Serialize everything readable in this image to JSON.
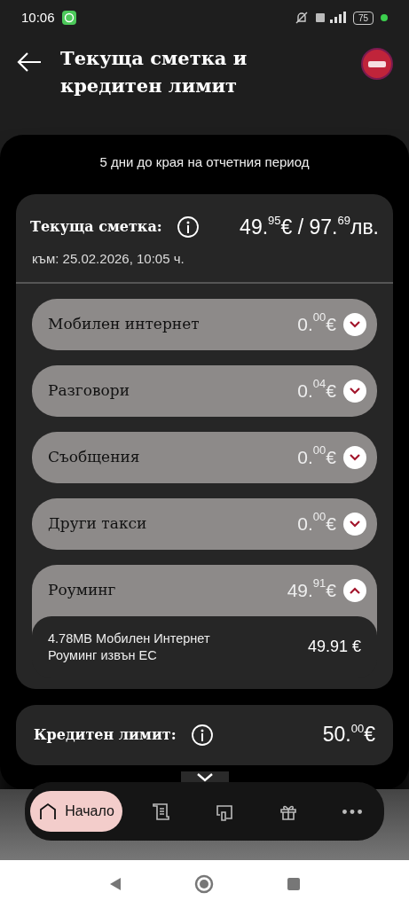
{
  "status_bar": {
    "time": "10:06",
    "battery": "75"
  },
  "header": {
    "title": "Текуща сметка и кредитен лимит"
  },
  "period_note": "5 дни до края на отчетния период",
  "current_bill": {
    "label": "Текуща сметка:",
    "amount": "49.$^{95}$€ / 97.$^{69}$лв.",
    "as_of": "към: 25.02.2026, 10:05 ч."
  },
  "categories": [
    {
      "label": "Мобилен интернет",
      "amount": "0.$^{00}$€",
      "expanded": false
    },
    {
      "label": "Разговори",
      "amount": "0.$^{04}$€",
      "expanded": false
    },
    {
      "label": "Съобщения",
      "amount": "0.$^{00}$€",
      "expanded": false
    },
    {
      "label": "Други такси",
      "amount": "0.$^{00}$€",
      "expanded": false
    },
    {
      "label": "Роуминг",
      "amount": "49.$^{91}$€",
      "expanded": true,
      "details": [
        {
          "description": "4.78MB Мобилен Интернет Роуминг извън ЕС",
          "amount": "49.91 €"
        }
      ]
    }
  ],
  "credit_limit": {
    "label": "Кредитен лимит:",
    "amount": "50.$^{00}$€"
  },
  "bottom_nav": [
    {
      "kind": "home",
      "label": "Начало",
      "selected": true
    },
    {
      "kind": "bills",
      "selected": false
    },
    {
      "kind": "devices",
      "selected": false
    },
    {
      "kind": "gift",
      "selected": false
    },
    {
      "kind": "more",
      "selected": false
    }
  ]
}
